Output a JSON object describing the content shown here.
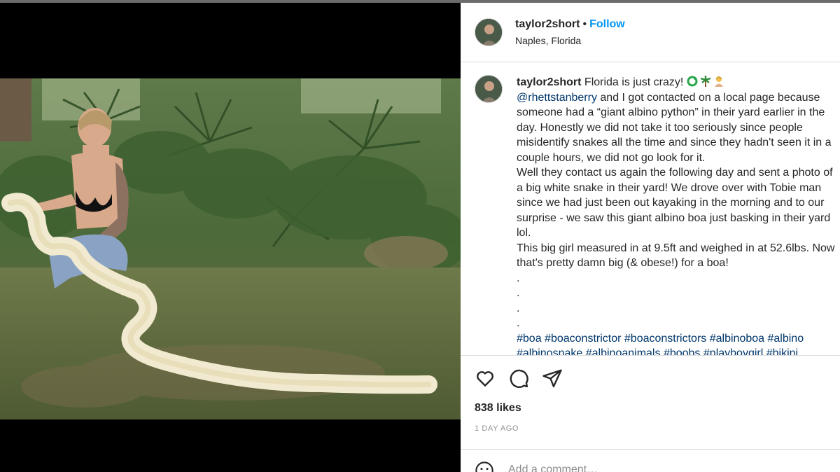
{
  "post": {
    "username": "taylor2short",
    "follow_label": "Follow",
    "separator": "•",
    "location": "Naples, Florida"
  },
  "caption": {
    "username": "taylor2short",
    "first_line": "Florida is just crazy!",
    "emojis": [
      "snake-emoji",
      "palm-tree-emoji",
      "person-shrugging-emoji"
    ],
    "mention": "@rhettstanberry",
    "line1_after_mention": " and I got contacted on a local page because",
    "lines": [
      "someone had a “giant albino python” in their yard earlier in the",
      "day. Honestly we did not take it too seriously since people",
      "misidentify snakes all the time and since they hadn't seen it in a",
      "couple hours, we did not go look for it.",
      "Well they contact us again the following day and sent a photo of",
      "a big white snake in their yard! We drove over with Tobie man",
      "since we had just been out kayaking in the morning and to our",
      "surprise - we saw this giant albino boa just basking in their yard",
      "lol.",
      "This big girl measured in at 9.5ft and weighed in at 52.6lbs. Now",
      "that's pretty damn big (& obese!) for a boa!",
      ".",
      ".",
      ".",
      "."
    ],
    "hashtags_line1": [
      "#boa",
      "#boaconstrictor",
      "#boaconstrictors",
      "#albinoboa",
      "#albino"
    ],
    "hashtags_line2": [
      "#albinosnake",
      "#albinoanimals",
      "#boobs",
      "#playboygirl",
      "#bikini"
    ]
  },
  "actions": {
    "icons": [
      "heart-icon",
      "comment-icon",
      "share-icon"
    ]
  },
  "likes": "838 likes",
  "time_ago": "1 DAY AGO",
  "comment": {
    "placeholder": "Add a comment…"
  },
  "colors": {
    "link": "#00376b",
    "follow": "#0095f6",
    "muted": "#8e8e8e",
    "border": "#dbdbdb"
  }
}
